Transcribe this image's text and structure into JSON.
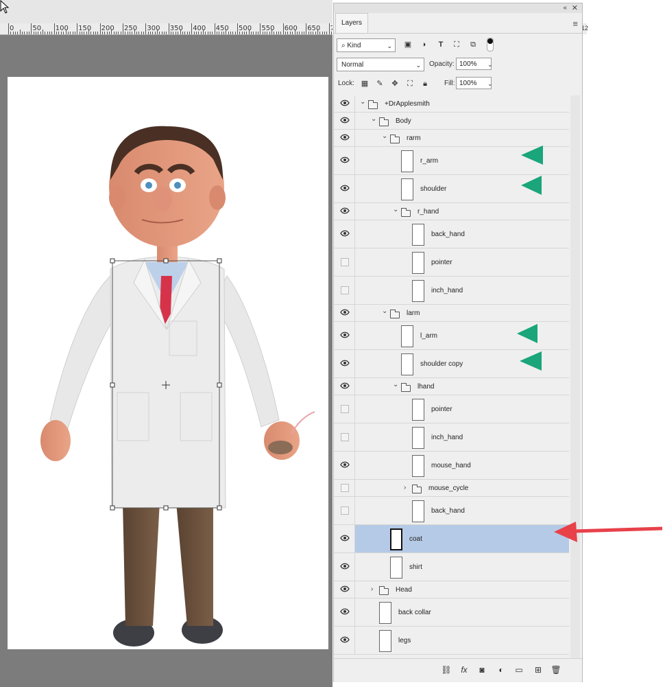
{
  "ruler": {
    "labels": [
      "0",
      "50",
      "100",
      "150",
      "200",
      "250",
      "300",
      "350",
      "400",
      "450",
      "500",
      "550",
      "600",
      "650",
      "7"
    ],
    "right_label": "12"
  },
  "panel": {
    "tab": "Layers",
    "collapse_icon": "«",
    "close_icon": "✕",
    "menu_icon": "≡",
    "filter": {
      "kind": "Kind",
      "kind_icon": "search-icon"
    },
    "blend_mode": "Normal",
    "opacity_label": "Opacity:",
    "opacity_value": "100%",
    "lock_label": "Lock:",
    "fill_label": "Fill:",
    "fill_value": "100%"
  },
  "layers": [
    {
      "name": "+DrApplesmith",
      "type": "group",
      "expanded": true,
      "visible": true
    },
    {
      "name": "Body",
      "type": "group",
      "expanded": true,
      "visible": true
    },
    {
      "name": "rarm",
      "type": "group",
      "expanded": true,
      "visible": true
    },
    {
      "name": "r_arm",
      "type": "layer",
      "visible": true
    },
    {
      "name": "shoulder",
      "type": "layer",
      "visible": true
    },
    {
      "name": "r_hand",
      "type": "group",
      "expanded": true,
      "visible": true
    },
    {
      "name": "back_hand",
      "type": "layer",
      "visible": true
    },
    {
      "name": "pointer",
      "type": "layer",
      "visible": false
    },
    {
      "name": "inch_hand",
      "type": "layer",
      "visible": false
    },
    {
      "name": "larm",
      "type": "group",
      "expanded": true,
      "visible": true
    },
    {
      "name": "l_arm",
      "type": "layer",
      "visible": true
    },
    {
      "name": "shoulder copy",
      "type": "layer",
      "visible": true
    },
    {
      "name": "lhand",
      "type": "group",
      "expanded": true,
      "visible": true
    },
    {
      "name": "pointer",
      "type": "layer",
      "visible": false
    },
    {
      "name": "inch_hand",
      "type": "layer",
      "visible": false
    },
    {
      "name": "mouse_hand",
      "type": "layer",
      "visible": true
    },
    {
      "name": "mouse_cycle",
      "type": "group",
      "expanded": false,
      "visible": false
    },
    {
      "name": "back_hand",
      "type": "layer",
      "visible": false
    },
    {
      "name": "coat",
      "type": "layer",
      "visible": true,
      "selected": true
    },
    {
      "name": "shirt",
      "type": "layer",
      "visible": true
    },
    {
      "name": "Head",
      "type": "group",
      "expanded": false,
      "visible": true
    },
    {
      "name": "back collar",
      "type": "layer",
      "visible": true
    },
    {
      "name": "legs",
      "type": "layer",
      "visible": true
    }
  ],
  "colors": {
    "selected_row": "#b5cae6",
    "annotation_green": "#1aa57a",
    "annotation_red": "#e8414a",
    "canvas_bg": "#7c7c7c"
  },
  "icons": {
    "filter_buttons": [
      "image-icon",
      "adjustment-icon",
      "type-icon",
      "shape-icon",
      "smart-object-icon"
    ],
    "lock_buttons": [
      "lock-transparent-icon",
      "lock-paint-icon",
      "lock-position-icon",
      "lock-artboard-icon",
      "lock-all-icon"
    ],
    "bottom_buttons": [
      "link-icon",
      "fx-icon",
      "mask-icon",
      "adjustment-layer-icon",
      "new-group-icon",
      "new-layer-icon",
      "trash-icon"
    ]
  }
}
